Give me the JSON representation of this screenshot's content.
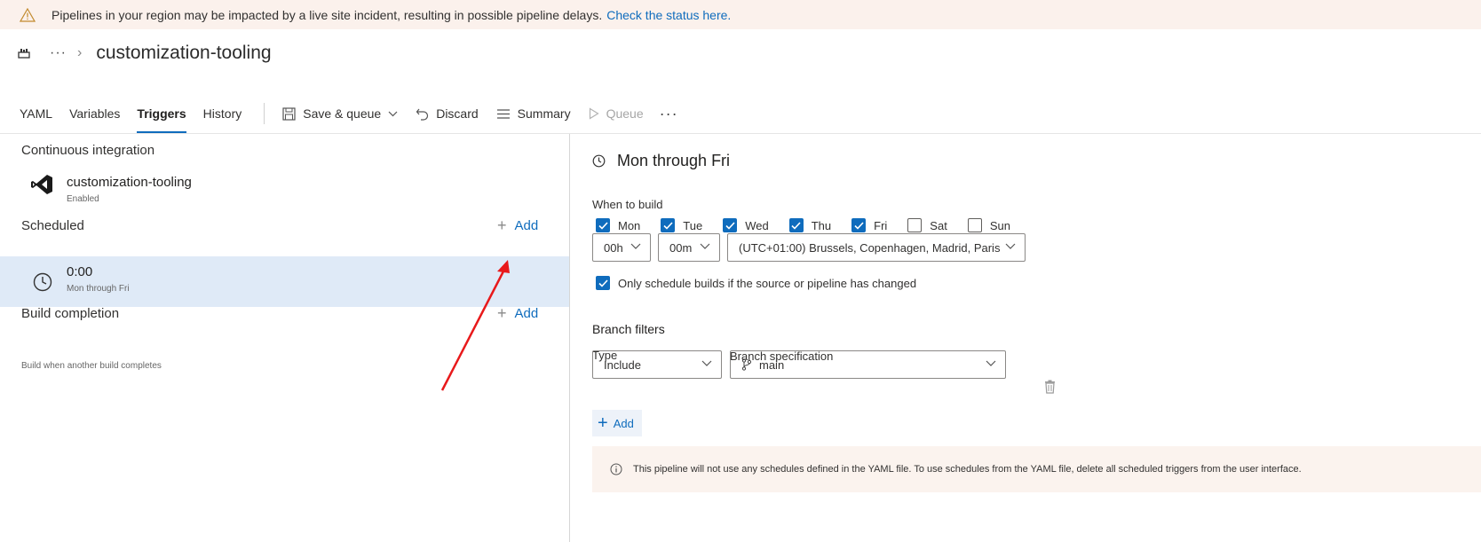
{
  "banner": {
    "icon": "warning-icon",
    "message": "Pipelines in your region may be impacted by a live site incident, resulting in possible pipeline delays.",
    "link": "Check the status here."
  },
  "breadcrumb": {
    "more": "···",
    "chevron": "›",
    "title": "customization-tooling"
  },
  "toolbar": {
    "tabs": [
      "YAML",
      "Variables",
      "Triggers",
      "History"
    ],
    "active_tab": "Triggers",
    "save_queue": "Save & queue",
    "discard": "Discard",
    "summary": "Summary",
    "queue": "Queue",
    "more": "···"
  },
  "left": {
    "ci_heading": "Continuous integration",
    "ci_item": {
      "name": "customization-tooling",
      "status": "Enabled"
    },
    "scheduled_heading": "Scheduled",
    "add_label": "Add",
    "schedule": {
      "time": "0:00",
      "days": "Mon through Fri"
    },
    "build_completion_heading": "Build completion",
    "build_completion_sub": "Build when another build completes"
  },
  "right": {
    "title": "Mon through Fri",
    "when_to_build": "When to build",
    "days": [
      {
        "label": "Mon",
        "checked": true
      },
      {
        "label": "Tue",
        "checked": true
      },
      {
        "label": "Wed",
        "checked": true
      },
      {
        "label": "Thu",
        "checked": true
      },
      {
        "label": "Fri",
        "checked": true
      },
      {
        "label": "Sat",
        "checked": false
      },
      {
        "label": "Sun",
        "checked": false
      }
    ],
    "hour": "00h",
    "minute": "00m",
    "timezone": "(UTC+01:00) Brussels, Copenhagen, Madrid, Paris",
    "only_changed": "Only schedule builds if the source or pipeline has changed",
    "only_changed_checked": true,
    "branch_filters": "Branch filters",
    "type_label": "Type",
    "type_value": "Include",
    "branch_spec_label": "Branch specification",
    "branch_value": "main",
    "add_label": "Add",
    "info": "This pipeline will not use any schedules defined in the YAML file. To use schedules from the YAML file, delete all scheduled triggers from the user interface."
  },
  "colors": {
    "accent": "#0f6cbd",
    "selected_row": "#dfeaf7",
    "banner": "#fbf1ec",
    "annotation_arrow": "#e8191b"
  }
}
